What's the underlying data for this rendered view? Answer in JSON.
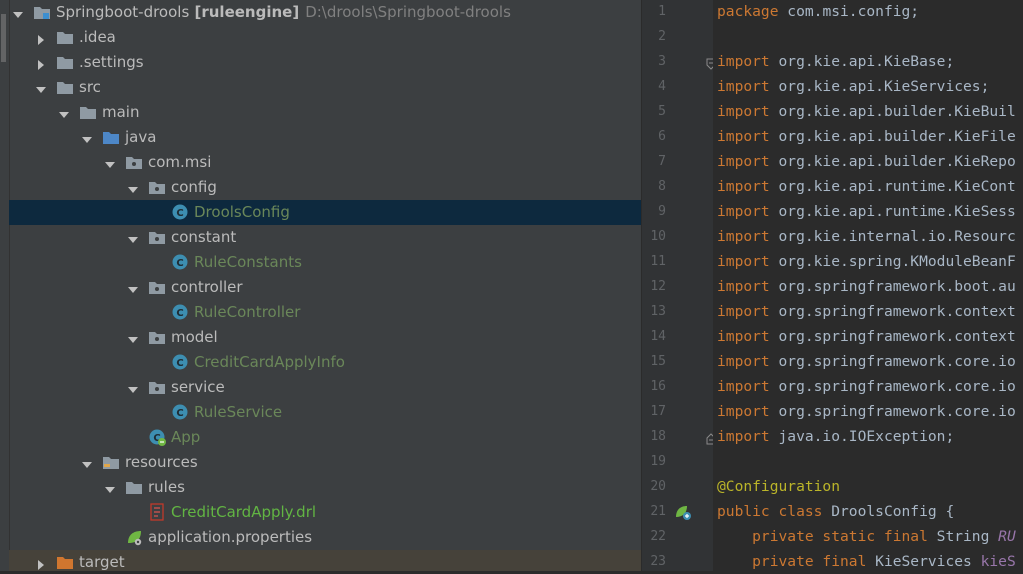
{
  "project_tree": {
    "items": [
      {
        "label": "Springboot-drools",
        "module": "[ruleengine]",
        "path": "D:\\drools\\Springboot-drools",
        "level": 0,
        "state": "expanded",
        "icon": "module-folder-icon"
      },
      {
        "label": ".idea",
        "level": 1,
        "state": "collapsed",
        "icon": "folder-icon"
      },
      {
        "label": ".settings",
        "level": 1,
        "state": "collapsed",
        "icon": "folder-icon"
      },
      {
        "label": "src",
        "level": 1,
        "state": "expanded",
        "icon": "folder-icon"
      },
      {
        "label": "main",
        "level": 2,
        "state": "expanded",
        "icon": "folder-icon"
      },
      {
        "label": "java",
        "level": 3,
        "state": "expanded",
        "icon": "source-folder-icon"
      },
      {
        "label": "com.msi",
        "level": 4,
        "state": "expanded",
        "icon": "package-icon"
      },
      {
        "label": "config",
        "level": 5,
        "state": "expanded",
        "icon": "package-icon"
      },
      {
        "label": "DroolsConfig",
        "level": 6,
        "state": "leaf",
        "icon": "class-icon",
        "selected": true
      },
      {
        "label": "constant",
        "level": 5,
        "state": "expanded",
        "icon": "package-icon"
      },
      {
        "label": "RuleConstants",
        "level": 6,
        "state": "leaf",
        "icon": "class-icon"
      },
      {
        "label": "controller",
        "level": 5,
        "state": "expanded",
        "icon": "package-icon"
      },
      {
        "label": "RuleController",
        "level": 6,
        "state": "leaf",
        "icon": "class-icon"
      },
      {
        "label": "model",
        "level": 5,
        "state": "expanded",
        "icon": "package-icon"
      },
      {
        "label": "CreditCardApplyInfo",
        "level": 6,
        "state": "leaf",
        "icon": "class-icon"
      },
      {
        "label": "service",
        "level": 5,
        "state": "expanded",
        "icon": "package-icon"
      },
      {
        "label": "RuleService",
        "level": 6,
        "state": "leaf",
        "icon": "class-icon"
      },
      {
        "label": "App",
        "level": 5,
        "state": "leaf",
        "icon": "spring-boot-class-icon"
      },
      {
        "label": "resources",
        "level": 3,
        "state": "expanded",
        "icon": "resources-folder-icon"
      },
      {
        "label": "rules",
        "level": 4,
        "state": "expanded",
        "icon": "folder-icon"
      },
      {
        "label": "CreditCardApply.drl",
        "level": 5,
        "state": "leaf",
        "icon": "drools-file-icon"
      },
      {
        "label": "application.properties",
        "level": 4,
        "state": "leaf",
        "icon": "spring-properties-icon"
      },
      {
        "label": "target",
        "level": 1,
        "state": "collapsed",
        "icon": "excluded-folder-icon",
        "highlighted": true
      }
    ]
  },
  "editor": {
    "line_numbers": [
      "1",
      "2",
      "3",
      "4",
      "5",
      "6",
      "7",
      "8",
      "9",
      "10",
      "11",
      "12",
      "13",
      "14",
      "15",
      "16",
      "17",
      "18",
      "19",
      "20",
      "21",
      "22",
      "23"
    ],
    "lines": [
      [
        {
          "t": "package",
          "c": "kw"
        },
        {
          "t": " com.msi.config;",
          "c": "txt"
        }
      ],
      [],
      [
        {
          "t": "import",
          "c": "kw"
        },
        {
          "t": " org.kie.api.KieBase;",
          "c": "txt"
        }
      ],
      [
        {
          "t": "import",
          "c": "kw"
        },
        {
          "t": " org.kie.api.KieServices;",
          "c": "txt"
        }
      ],
      [
        {
          "t": "import",
          "c": "kw"
        },
        {
          "t": " org.kie.api.builder.KieBuil",
          "c": "txt"
        }
      ],
      [
        {
          "t": "import",
          "c": "kw"
        },
        {
          "t": " org.kie.api.builder.KieFile",
          "c": "txt"
        }
      ],
      [
        {
          "t": "import",
          "c": "kw"
        },
        {
          "t": " org.kie.api.builder.KieRepo",
          "c": "txt"
        }
      ],
      [
        {
          "t": "import",
          "c": "kw"
        },
        {
          "t": " org.kie.api.runtime.KieCont",
          "c": "txt"
        }
      ],
      [
        {
          "t": "import",
          "c": "kw"
        },
        {
          "t": " org.kie.api.runtime.KieSess",
          "c": "txt"
        }
      ],
      [
        {
          "t": "import",
          "c": "kw"
        },
        {
          "t": " org.kie.internal.io.Resourc",
          "c": "txt"
        }
      ],
      [
        {
          "t": "import",
          "c": "kw"
        },
        {
          "t": " org.kie.spring.KModuleBeanF",
          "c": "txt"
        }
      ],
      [
        {
          "t": "import",
          "c": "kw"
        },
        {
          "t": " org.springframework.boot.au",
          "c": "txt"
        }
      ],
      [
        {
          "t": "import",
          "c": "kw"
        },
        {
          "t": " org.springframework.context",
          "c": "txt"
        }
      ],
      [
        {
          "t": "import",
          "c": "kw"
        },
        {
          "t": " org.springframework.context",
          "c": "txt"
        }
      ],
      [
        {
          "t": "import",
          "c": "kw"
        },
        {
          "t": " org.springframework.core.io",
          "c": "txt"
        }
      ],
      [
        {
          "t": "import",
          "c": "kw"
        },
        {
          "t": " org.springframework.core.io",
          "c": "txt"
        }
      ],
      [
        {
          "t": "import",
          "c": "kw"
        },
        {
          "t": " org.springframework.core.io",
          "c": "txt"
        }
      ],
      [
        {
          "t": "import",
          "c": "kw"
        },
        {
          "t": " java.io.IOException;",
          "c": "txt"
        }
      ],
      [],
      [
        {
          "t": "@Configuration",
          "c": "ann"
        }
      ],
      [
        {
          "t": "public class",
          "c": "kw"
        },
        {
          "t": " DroolsConfig {",
          "c": "txt"
        }
      ],
      [
        {
          "t": "    private static final",
          "c": "kw"
        },
        {
          "t": " String ",
          "c": "txt"
        },
        {
          "t": "RU",
          "c": "cst"
        }
      ],
      [
        {
          "t": "    private final",
          "c": "kw"
        },
        {
          "t": " KieServices ",
          "c": "txt"
        },
        {
          "t": "kieS",
          "c": "fld"
        }
      ]
    ]
  },
  "colors": {
    "tree_background": "#3c3f41",
    "editor_background": "#2b2b2b",
    "selection": "#0d293e",
    "keyword": "#cc7832",
    "annotation": "#bbb529",
    "class_name_green": "#6a8759"
  }
}
